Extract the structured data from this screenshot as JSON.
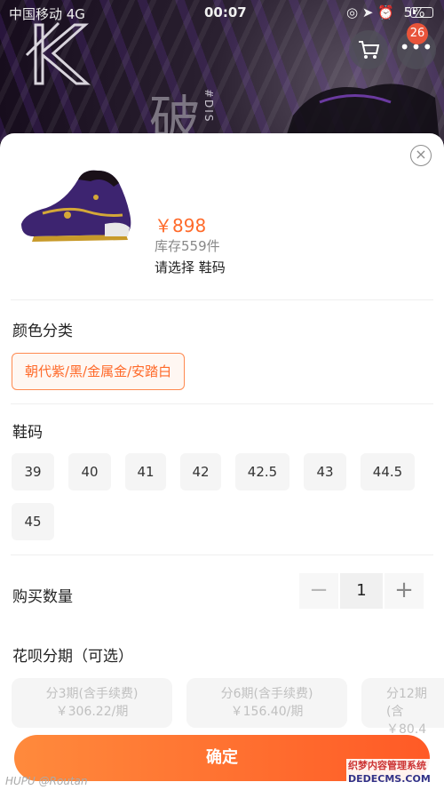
{
  "status_bar": {
    "carrier": "中国移动  4G",
    "time": "00:07",
    "battery": "5%"
  },
  "header": {
    "cart_count": "26",
    "more_label": "•••",
    "cart_icon": "cart-icon",
    "bg_char": "破",
    "bg_vertical": "#DIS"
  },
  "sheet": {
    "close_icon": "close-icon",
    "price": "￥898",
    "stock": "库存559件",
    "select_hint": "请选择 鞋码"
  },
  "color": {
    "title": "颜色分类",
    "options": [
      "朝代紫/黑/金属金/安踏白"
    ]
  },
  "size": {
    "title": "鞋码",
    "options": [
      "39",
      "40",
      "41",
      "42",
      "42.5",
      "43",
      "44.5",
      "45"
    ]
  },
  "quantity": {
    "title": "购买数量",
    "minus": "−",
    "value": "1",
    "plus": "+"
  },
  "installment": {
    "title": "花呗分期（可选）",
    "options": [
      {
        "period": "分3期(含手续费)",
        "amount": "￥306.22/期"
      },
      {
        "period": "分6期(含手续费)",
        "amount": "￥156.40/期"
      },
      {
        "period": "分12期(含",
        "amount": "￥80.4"
      }
    ]
  },
  "confirm_label": "确定",
  "watermarks": {
    "left": "HUPU @Routan",
    "right_line1": "织梦内容管理系统",
    "right_line2": "DEDECMS.COM"
  },
  "colors": {
    "accent": "#ff6a2a",
    "button_start": "#ff8a3c",
    "button_end": "#ff5a26"
  }
}
